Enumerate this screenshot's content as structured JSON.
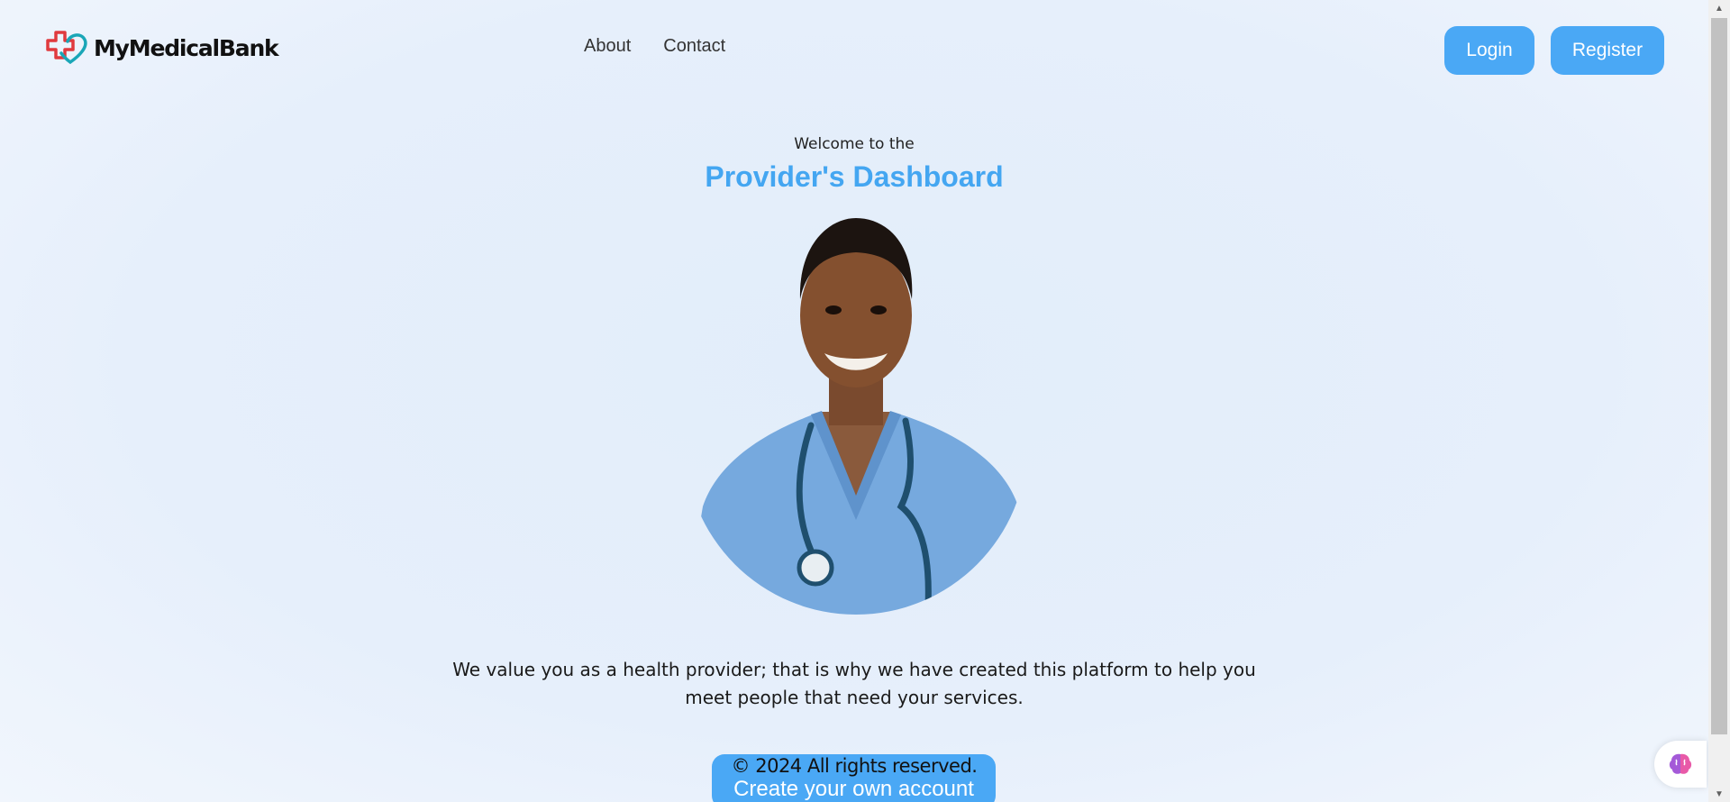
{
  "header": {
    "logo_text": "MyMedicalBank",
    "nav": [
      {
        "label": "About"
      },
      {
        "label": "Contact"
      }
    ],
    "login_label": "Login",
    "register_label": "Register"
  },
  "hero": {
    "welcome": "Welcome to the",
    "title": "Provider's Dashboard",
    "description": "We value you as a health provider; that is why we have created this platform to help you meet people that need your services.",
    "cta_label": "Create your own account"
  },
  "footer": {
    "copyright": "© 2024 All rights reserved."
  },
  "colors": {
    "accent": "#4aa8f5",
    "title": "#44a6f1",
    "logo_red": "#e03a3e",
    "logo_teal": "#1aa6b7"
  },
  "icons": {
    "logo": "medical-cross-heart-logo-icon",
    "widget": "brain-icon",
    "scroll_up": "triangle-up-icon",
    "scroll_down": "triangle-down-icon"
  }
}
